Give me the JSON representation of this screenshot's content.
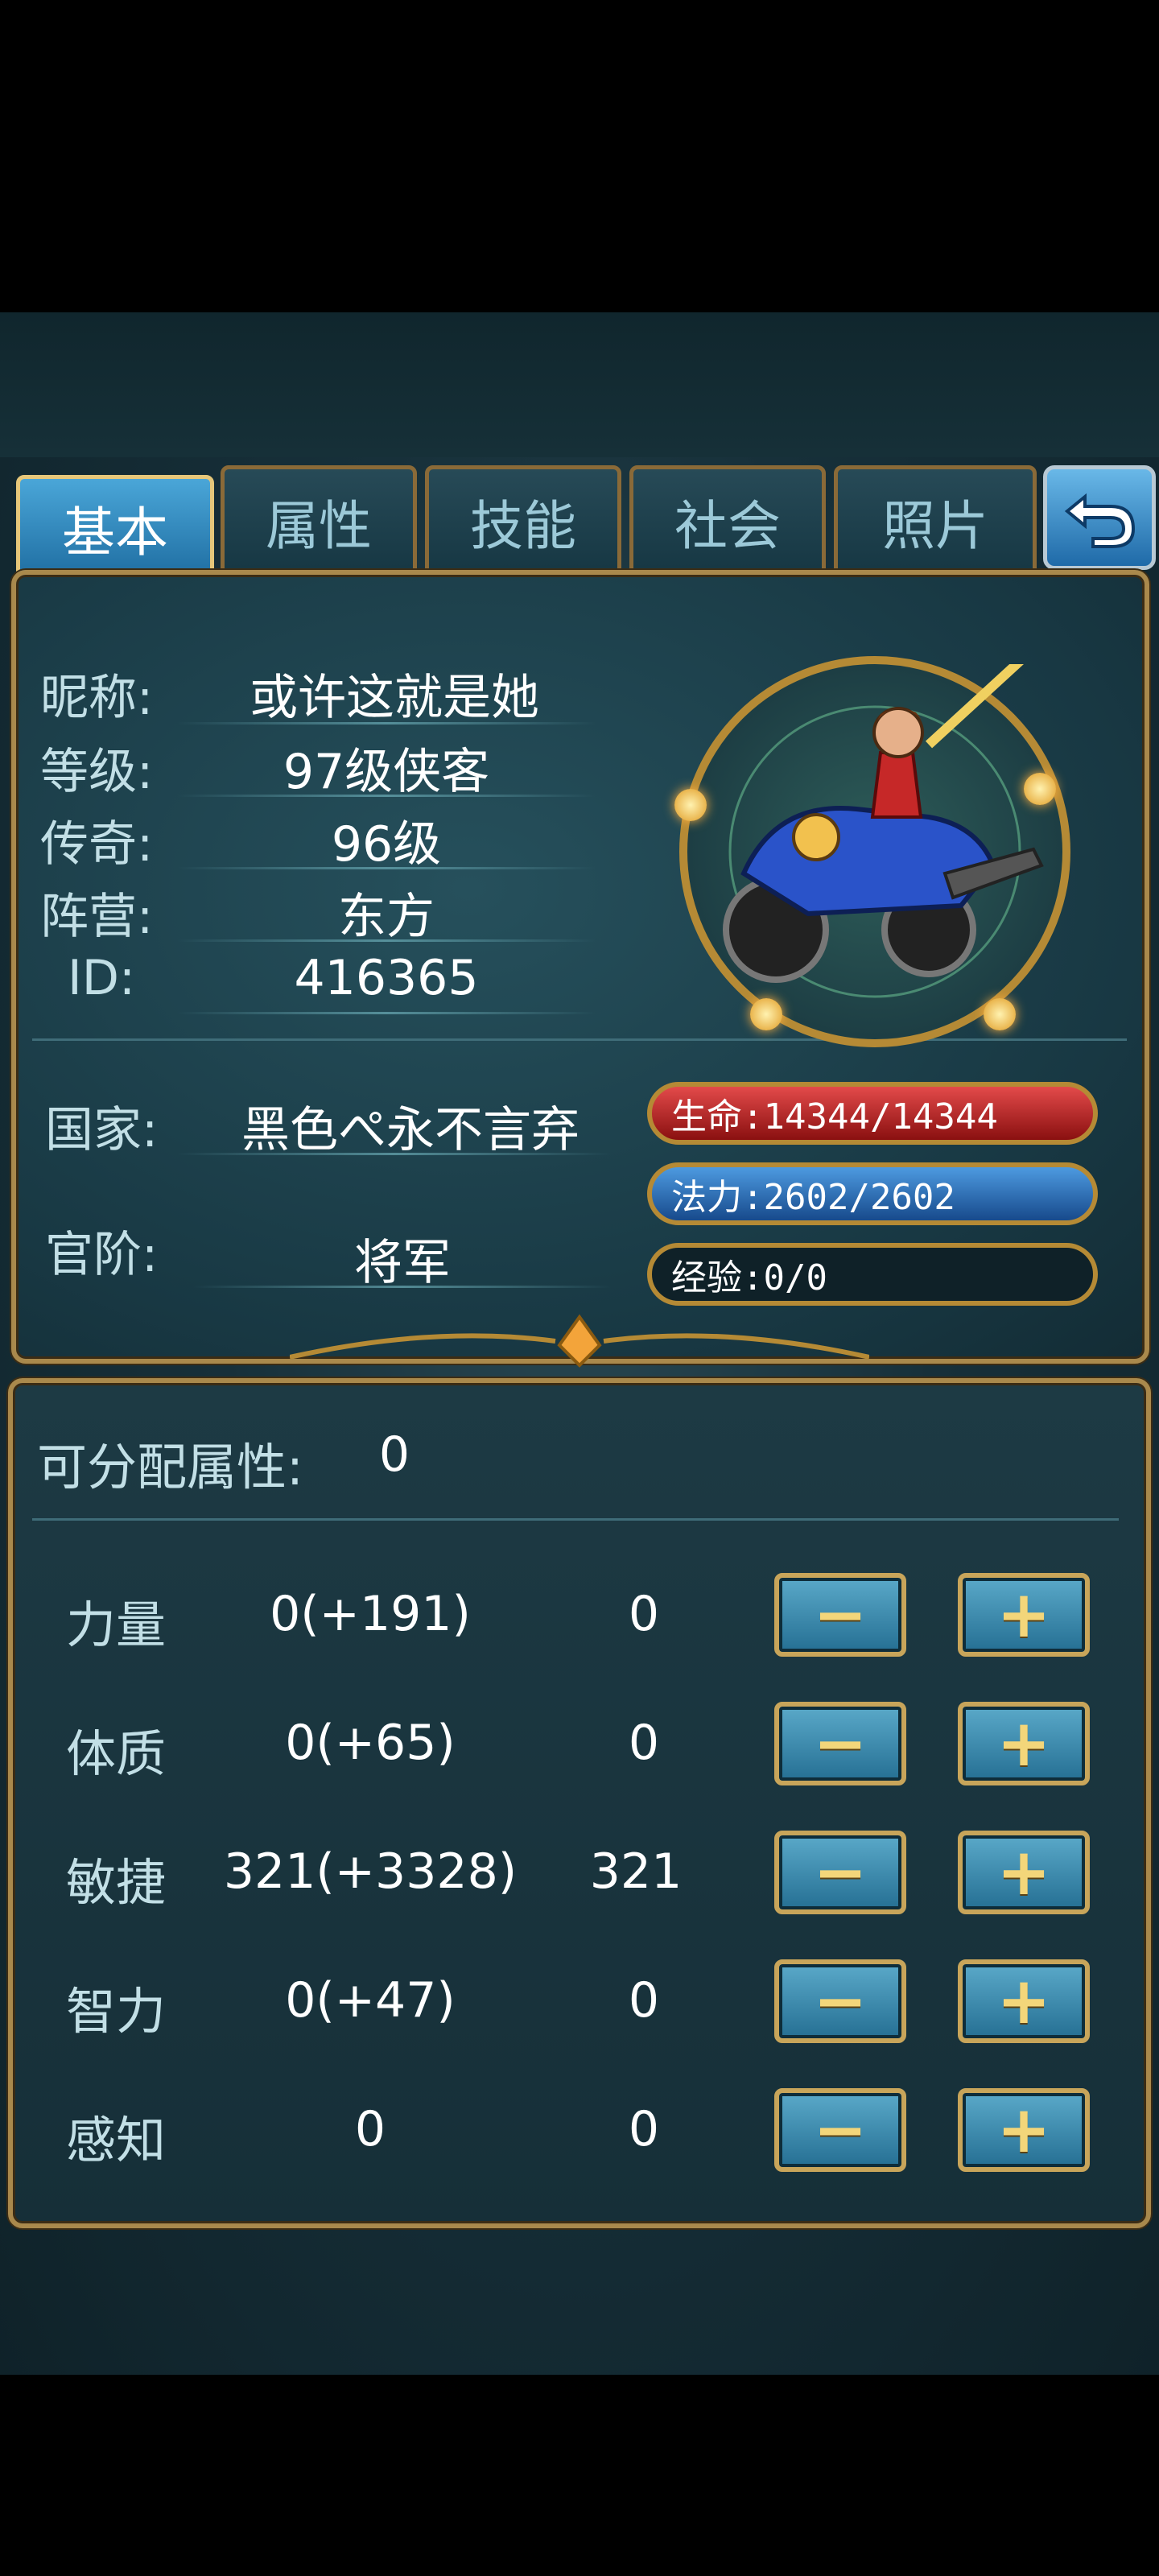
{
  "tabs": [
    {
      "label": "基本",
      "active": true
    },
    {
      "label": "属性",
      "active": false
    },
    {
      "label": "技能",
      "active": false
    },
    {
      "label": "社会",
      "active": false
    },
    {
      "label": "照片",
      "active": false
    }
  ],
  "back_icon": "back-arrow-icon",
  "profile": {
    "nickname_label": "昵称:",
    "nickname": "或许这就是她",
    "level_label": "等级:",
    "level": "97级侠客",
    "legend_label": "传奇:",
    "legend": "96级",
    "camp_label": "阵营:",
    "camp": "东方",
    "id_label": "ID:",
    "id": "416365",
    "country_label": "国家:",
    "country": "黑色ぺ永不言弃",
    "rank_label": "官阶:",
    "rank": "将军"
  },
  "bars": {
    "hp": "生命:14344/14344",
    "mp": "法力:2602/2602",
    "xp": "经验:0/0"
  },
  "attributes": {
    "points_label": "可分配属性:",
    "points": "0",
    "rows": [
      {
        "name": "力量",
        "base": "0(+191)",
        "alloc": "0"
      },
      {
        "name": "体质",
        "base": "0(+65)",
        "alloc": "0"
      },
      {
        "name": "敏捷",
        "base": "321(+3328)",
        "alloc": "321"
      },
      {
        "name": "智力",
        "base": "0(+47)",
        "alloc": "0"
      },
      {
        "name": "感知",
        "base": "0",
        "alloc": "0"
      }
    ],
    "minus_glyph": "−",
    "plus_glyph": "+"
  },
  "colors": {
    "accent_gold": "#b58a35",
    "hp_red": "#c62828",
    "mp_blue": "#2a6fb8"
  }
}
